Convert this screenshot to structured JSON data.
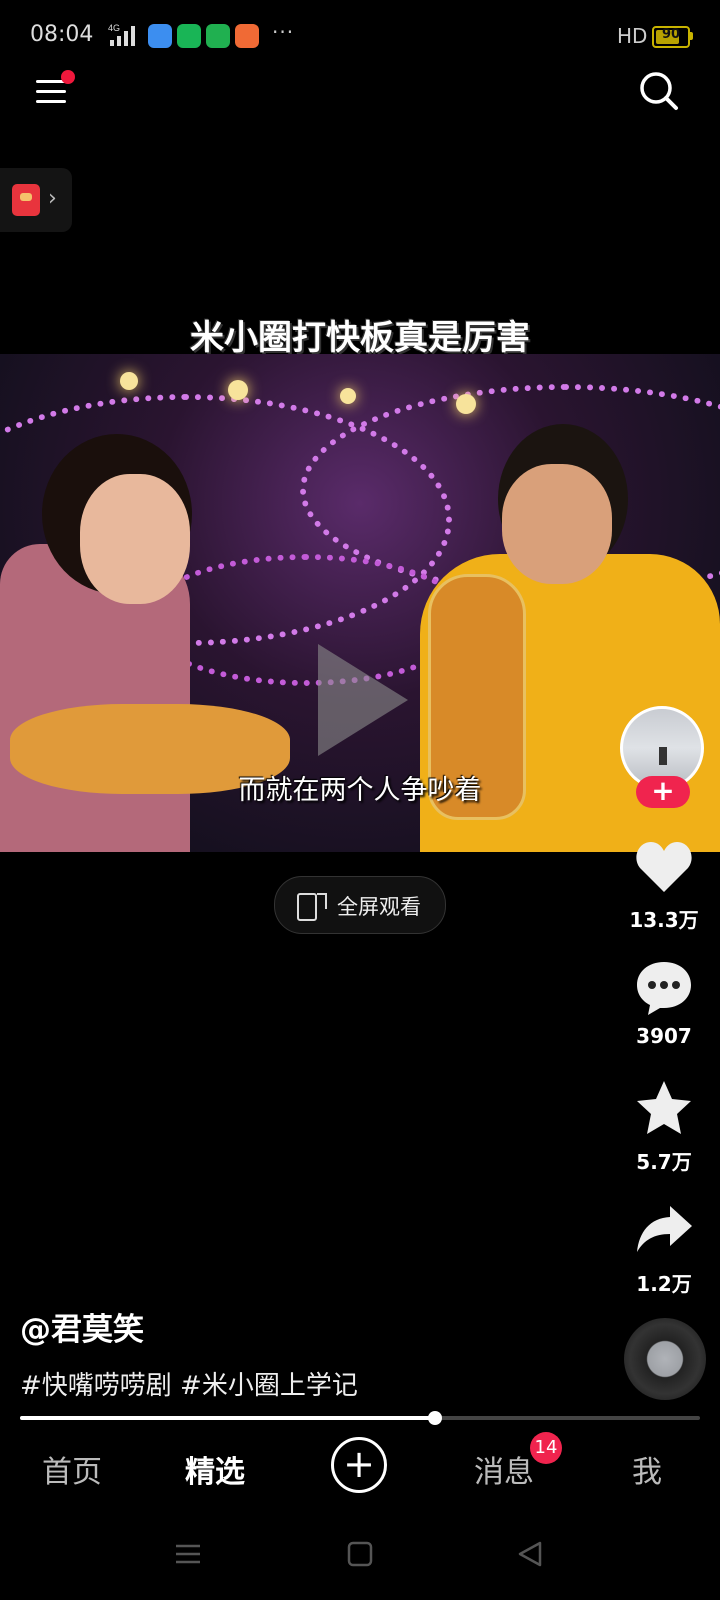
{
  "status_bar": {
    "time": "08:04",
    "network": "4G",
    "more": "···",
    "hd": "HD",
    "battery": "90",
    "battery_level": 0.9,
    "app_icons": [
      {
        "name": "browser-app-icon",
        "color": "#3c8ef0"
      },
      {
        "name": "wechat-app-icon",
        "color": "#19b556"
      },
      {
        "name": "wallet-app-icon",
        "color": "#20b050"
      },
      {
        "name": "reader-app-icon",
        "color": "#f06a35"
      }
    ]
  },
  "top_nav": {
    "menu_icon": "hamburger-menu-icon",
    "search_icon": "search-icon"
  },
  "video": {
    "title": "米小圈打快板真是厉害",
    "subtitle": "而就在两个人争吵着",
    "fullscreen_label": "全屏观看"
  },
  "actions": {
    "likes": "13.3万",
    "comments": "3907",
    "favorites": "5.7万",
    "shares": "1.2万",
    "follow": "+"
  },
  "post": {
    "author": "@君莫笑",
    "tags": "#快嘴唠唠剧 #米小圈上学记",
    "progress": 0.61
  },
  "bottom_nav": {
    "items": [
      "首页",
      "精选",
      "消息",
      "我"
    ],
    "active": "精选",
    "add": "+",
    "message_badge": "14"
  },
  "colors": {
    "accent": "#f0244e",
    "background": "#000000"
  }
}
